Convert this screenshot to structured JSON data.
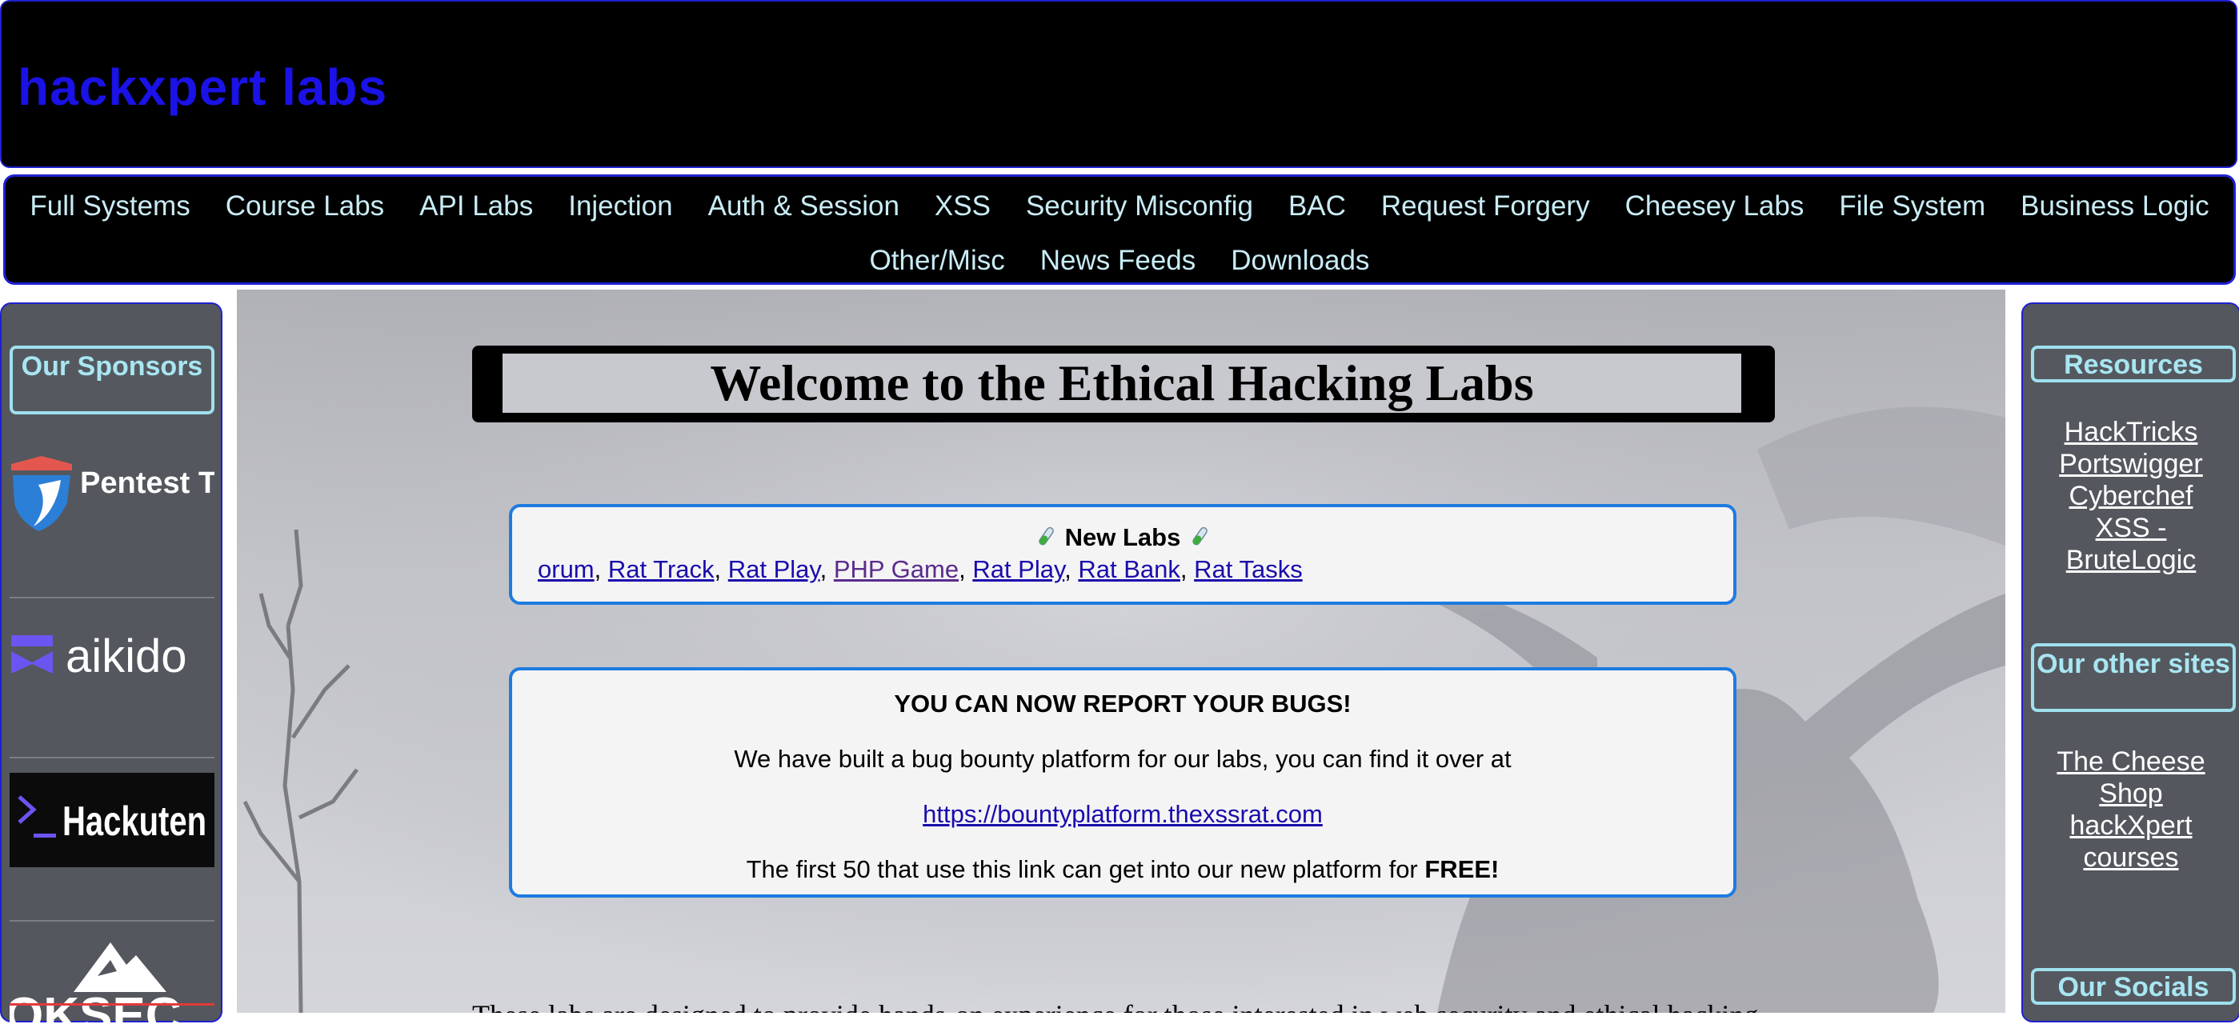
{
  "header": {
    "site_title": "hackxpert labs"
  },
  "nav": {
    "row1": [
      "Full Systems",
      "Course Labs",
      "API Labs",
      "Injection",
      "Auth & Session",
      "XSS",
      "Security Misconfig",
      "BAC",
      "Request Forgery",
      "Cheesey Labs",
      "File System",
      "Business Logic"
    ],
    "row2": [
      "Other/Misc",
      "News Feeds",
      "Downloads"
    ]
  },
  "left_sidebar": {
    "heading": "Our Sponsors",
    "sponsors": [
      "Pentest Tools",
      "aikido",
      "Hackuten",
      "OKSEC"
    ]
  },
  "right_sidebar": {
    "resources_heading": "Resources",
    "resources": [
      "HackTricks",
      "Portswigger",
      "Cyberchef",
      "XSS - BruteLogic"
    ],
    "other_sites_heading": "Our other sites",
    "other_sites": [
      "The Cheese Shop",
      "hackXpert courses"
    ],
    "socials_heading": "Our Socials"
  },
  "main": {
    "welcome": "Welcome to the Ethical Hacking Labs",
    "new_labs": {
      "title": "New Labs",
      "links": [
        "orum",
        "Rat Track",
        "Rat Play",
        "PHP Game",
        "Rat Play",
        "Rat Bank",
        "Rat Tasks"
      ]
    },
    "bugs": {
      "heading": "YOU CAN NOW REPORT YOUR BUGS!",
      "line1": "We have built a bug bounty platform for our labs, you can find it over at",
      "link": "https://bountyplatform.thexssrat.com",
      "line3_pre": "The first 50 that use this link can get into our new platform for ",
      "line3_bold": "FREE!"
    },
    "bottom_text": "These labs are designed to provide hands-on experience for those interested in web security and ethical hacking"
  },
  "colors": {
    "header_bg": "#000000",
    "title_blue": "#1a12e6",
    "nav_text": "#c9ecf5",
    "sidebar_bg": "#54575d",
    "heading_border": "#9fe0ee",
    "card_border": "#1e7be0"
  }
}
